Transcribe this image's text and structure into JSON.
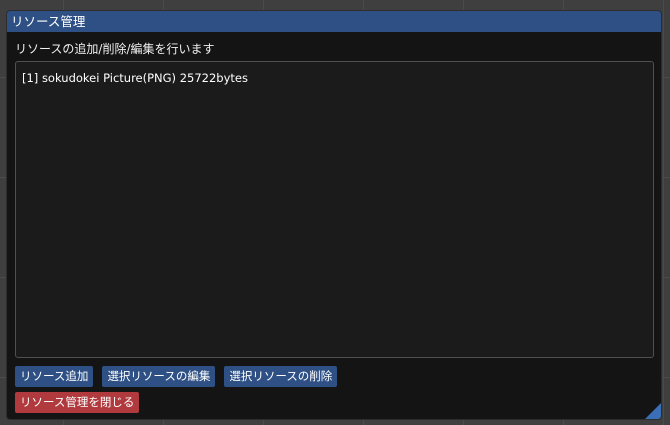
{
  "window": {
    "title": "リソース管理",
    "description": "リソースの追加/削除/編集を行います"
  },
  "resources": [
    {
      "label": "[1] sokudokei Picture(PNG) 25722bytes"
    }
  ],
  "buttons": {
    "add": "リソース追加",
    "edit": "選択リソースの編集",
    "delete": "選択リソースの削除",
    "close": "リソース管理を閉じる"
  },
  "colors": {
    "titlebar": "#2e5084",
    "button": "#2e5084",
    "close_button": "#b03a3e",
    "background": "#141414"
  }
}
